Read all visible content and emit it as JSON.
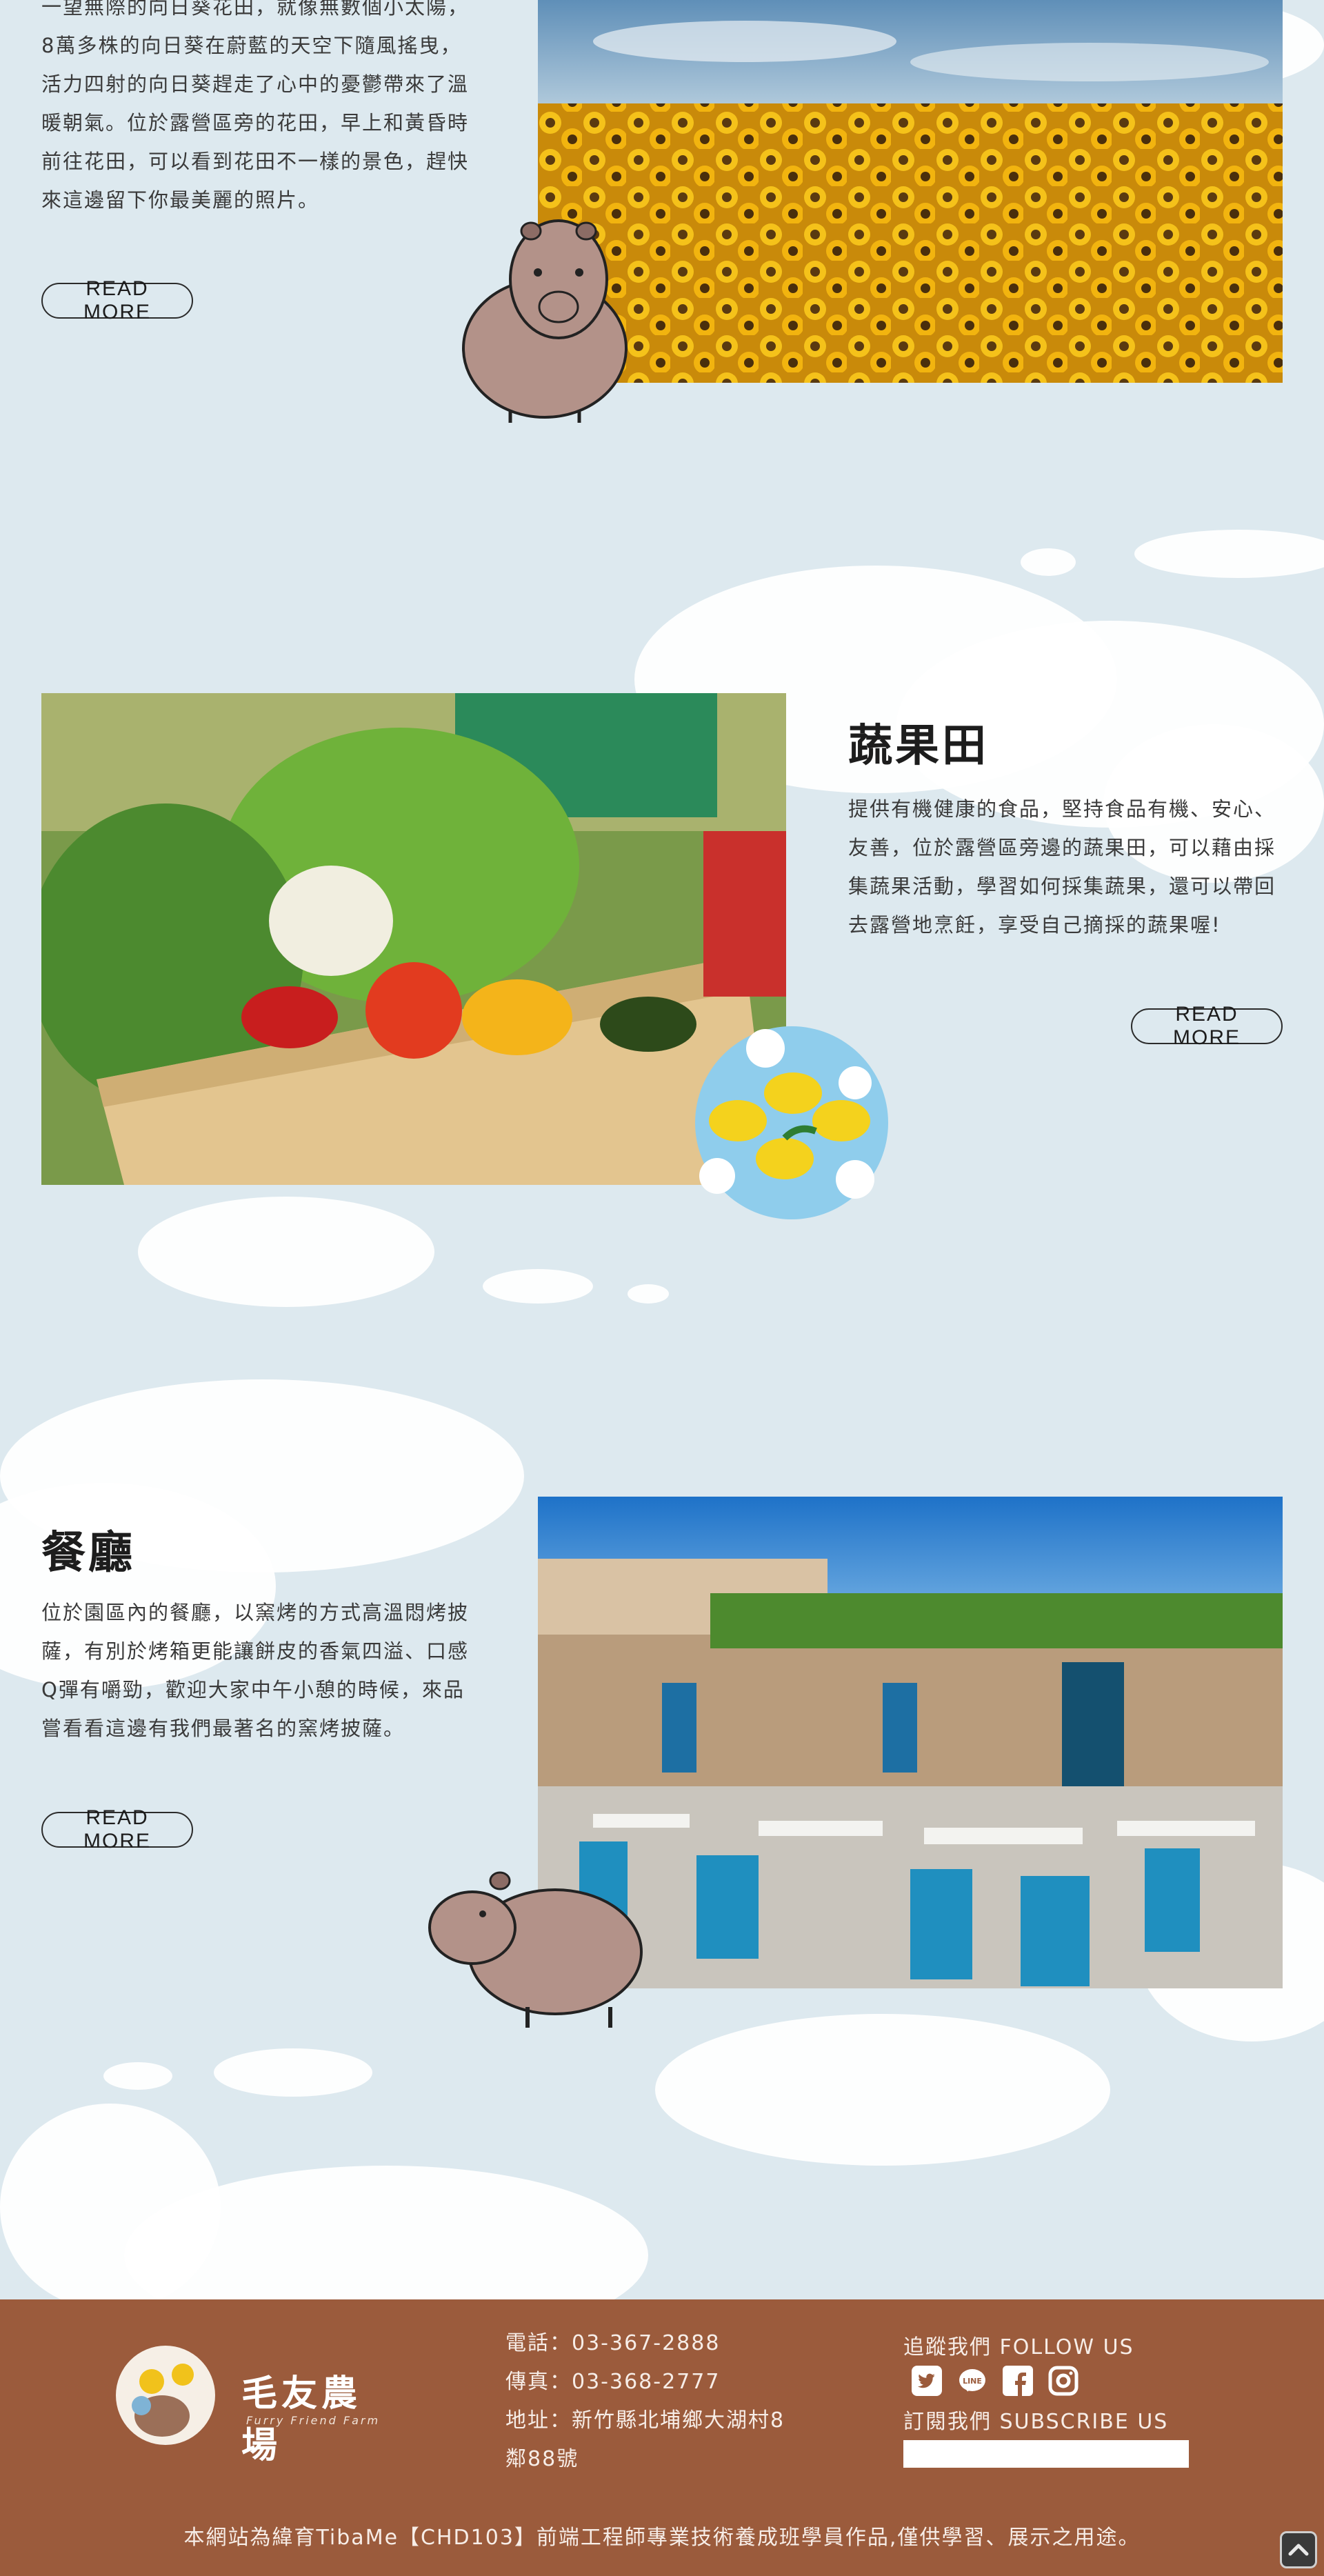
{
  "sunflower": {
    "desc_lines": [
      "一望無際的向日葵花田，就像無數個小太陽，",
      "8萬多株的向日葵在蔚藍的天空下隨風搖曳，",
      "活力四射的向日葵趕走了心中的憂鬱帶來了溫",
      "暖朝氣。位於露營區旁的花田，早上和黃昏時",
      "前往花田，可以看到花田不一樣的景色，趕快",
      "來這邊留下你最美麗的照片。"
    ],
    "read_more": "READ MORE"
  },
  "vegetable": {
    "title": "蔬果田",
    "desc_lines": [
      "提供有機健康的食品，堅持食品有機、安心、",
      "友善，位於露營區旁邊的蔬果田，可以藉由採",
      "集蔬果活動，學習如何採集蔬果，還可以帶回",
      "去露營地烹飪，享受自己摘採的蔬果喔!"
    ],
    "read_more": "READ MORE"
  },
  "restaurant": {
    "title": "餐廳",
    "desc_lines": [
      "位於園區內的餐廳，以窯烤的方式高溫悶烤披",
      "薩，有別於烤箱更能讓餅皮的香氣四溢、口感",
      "Q彈有嚼勁，歡迎大家中午小憩的時候，來品",
      "嘗看看這邊有我們最著名的窯烤披薩。"
    ],
    "read_more": "READ MORE"
  },
  "footer": {
    "logo_text": "毛友農場",
    "logo_sub": "Furry Friend Farm",
    "phone": "電話：03-367-2888",
    "fax": "傳真：03-368-2777",
    "address_line1": "地址：新竹縣北埔鄉大湖村8",
    "address_line2": "鄰88號",
    "follow": "追蹤我們 FOLLOW US",
    "subscribe": "訂閱我們 SUBSCRIBE US",
    "social_icons": [
      "twitter-icon",
      "line-icon",
      "facebook-icon",
      "instagram-icon"
    ],
    "copyright": "本網站為緯育TibaMe【CHD103】前端工程師專業技術養成班學員作品,僅供學習、展示之用途。"
  },
  "colors": {
    "background": "#dde9ef",
    "footer": "#9b5b3c",
    "cloud": "#ffffff"
  }
}
